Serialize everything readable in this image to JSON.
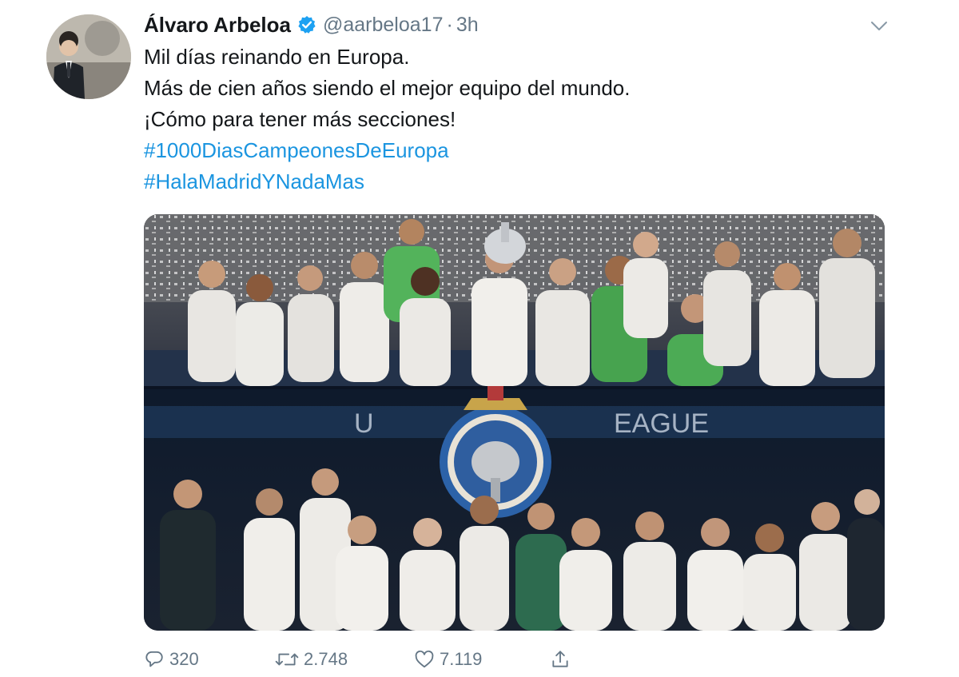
{
  "tweet": {
    "author_name": "Álvaro Arbeloa",
    "handle": "@aarbeloa17",
    "separator": "·",
    "time": "3h",
    "lines": [
      "Mil días reinando en Europa.",
      "Más de cien años siendo el mejor equipo del mundo.",
      "¡Cómo para tener más secciones!"
    ],
    "hashtags": [
      "#1000DiasCampeonesDeEuropa",
      "#HalaMadridYNadaMas"
    ],
    "media": {
      "banner_text_left": "U",
      "banner_text_right": "EAGUE"
    }
  },
  "actions": {
    "replies": "320",
    "retweets": "2.748",
    "likes": "7.119"
  },
  "icons": {
    "verified": "verified-badge-icon",
    "menu": "chevron-down-icon",
    "reply": "reply-icon",
    "retweet": "retweet-icon",
    "like": "heart-icon",
    "share": "share-icon"
  },
  "colors": {
    "text": "#14171a",
    "secondary": "#657786",
    "link": "#1b95e0",
    "verified": "#1da1f2"
  }
}
